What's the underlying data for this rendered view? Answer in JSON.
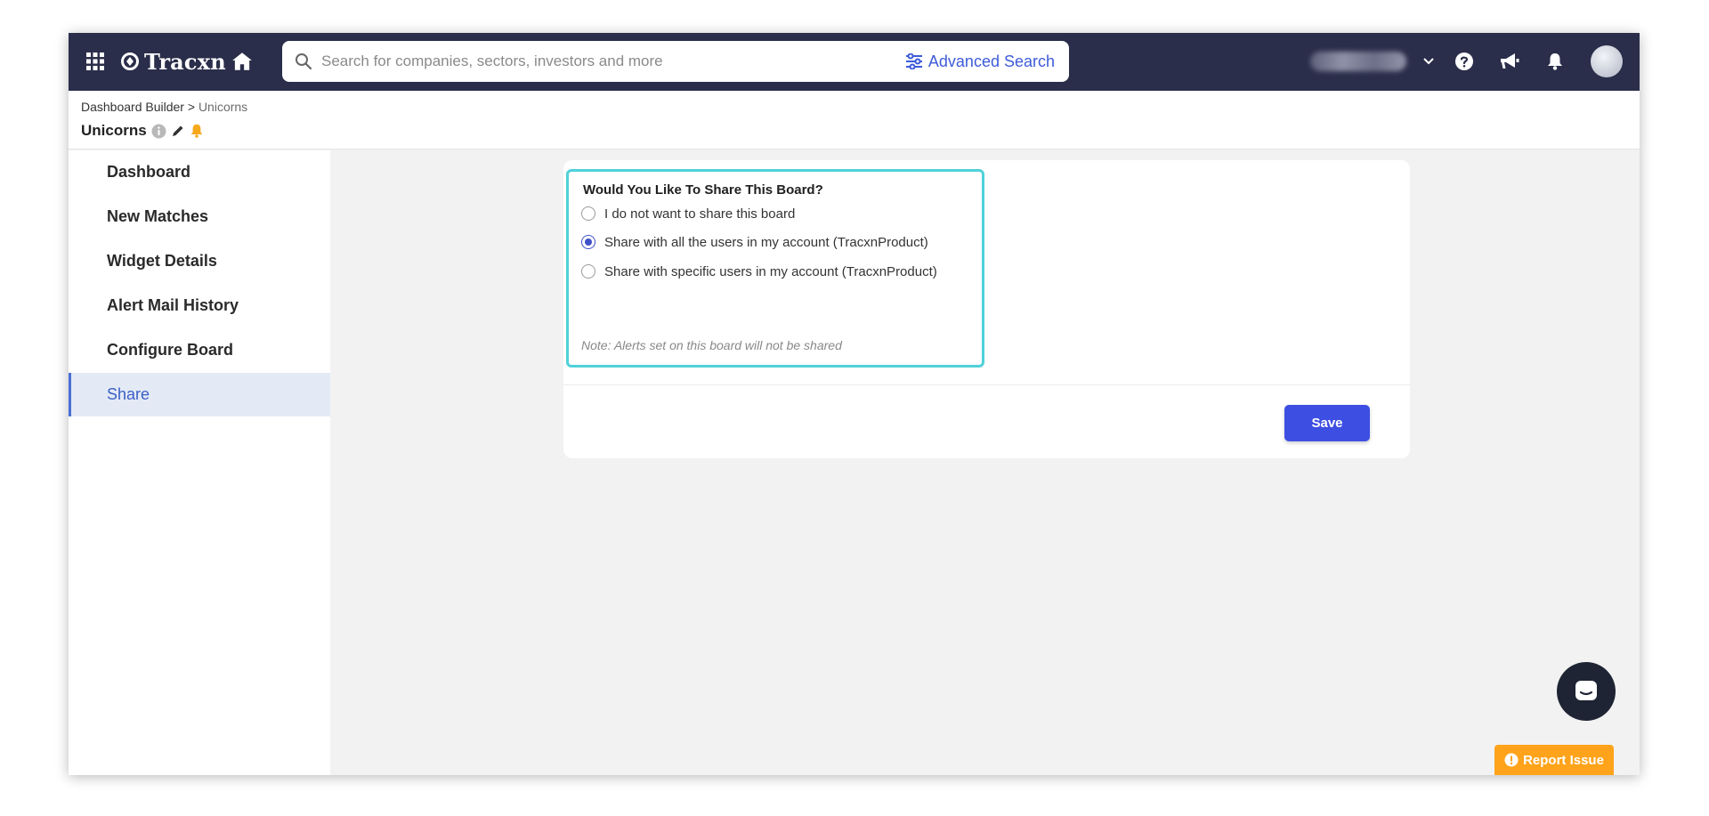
{
  "app": {
    "logo_text": "Tracxn"
  },
  "search": {
    "placeholder": "Search for companies, sectors, investors and more",
    "advanced_label": "Advanced Search"
  },
  "breadcrumb": {
    "parent": "Dashboard Builder",
    "separator": " > ",
    "current": "Unicorns"
  },
  "board": {
    "title": "Unicorns"
  },
  "sidebar": {
    "items": [
      {
        "label": "Dashboard"
      },
      {
        "label": "New Matches"
      },
      {
        "label": "Widget Details"
      },
      {
        "label": "Alert Mail History"
      },
      {
        "label": "Configure Board"
      },
      {
        "label": "Share",
        "active": true
      }
    ]
  },
  "share": {
    "title": "Would You Like To Share This Board?",
    "options": [
      {
        "label": "I do not want to share this board",
        "selected": false
      },
      {
        "label": "Share with all the users in my account (TracxnProduct)",
        "selected": true
      },
      {
        "label": "Share with specific users in my account (TracxnProduct)",
        "selected": false
      }
    ],
    "note": "Note: Alerts set on this board will not be shared",
    "save_label": "Save"
  },
  "report": {
    "label": "Report Issue"
  },
  "colors": {
    "nav_bg": "#2b2e4a",
    "accent": "#3d4ee2",
    "highlight_border": "#4fd1d9",
    "report_bg": "#ffa31a"
  }
}
